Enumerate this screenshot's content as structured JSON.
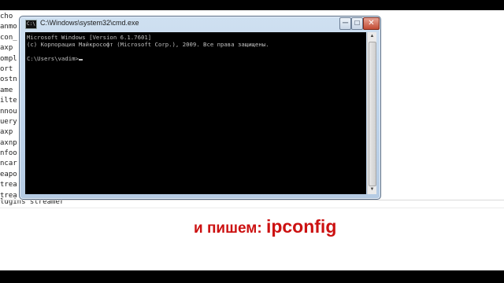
{
  "background_lines": [
    "cho",
    "anmo",
    "con_",
    "axp",
    "ompl",
    "ort",
    "ostn",
    "ame",
    "ilte",
    "nnou",
    "uery",
    "axp",
    "axnp",
    "nfoo",
    "ncar",
    "eapo",
    "trea",
    "trea"
  ],
  "background_last_line": "lugins streamer",
  "window": {
    "title": "C:\\Windows\\system32\\cmd.exe",
    "icon_label": "C:\\",
    "controls": {
      "minimize": "─",
      "maximize": "□",
      "close": "✕"
    }
  },
  "console": {
    "line1": "Microsoft Windows [Version 6.1.7601]",
    "line2": "(c) Корпорация Майкрософт (Microsoft Corp.), 2009. Все права защищены.",
    "blank": "",
    "prompt": "C:\\Users\\vadim>"
  },
  "scrollbar": {
    "up": "▲",
    "down": "▼"
  },
  "caption": {
    "lead": "и пишем: ",
    "command": "ipconfig"
  },
  "colors": {
    "console_bg": "#000000",
    "console_text": "#c0c0c0",
    "caption": "#cc1111"
  }
}
